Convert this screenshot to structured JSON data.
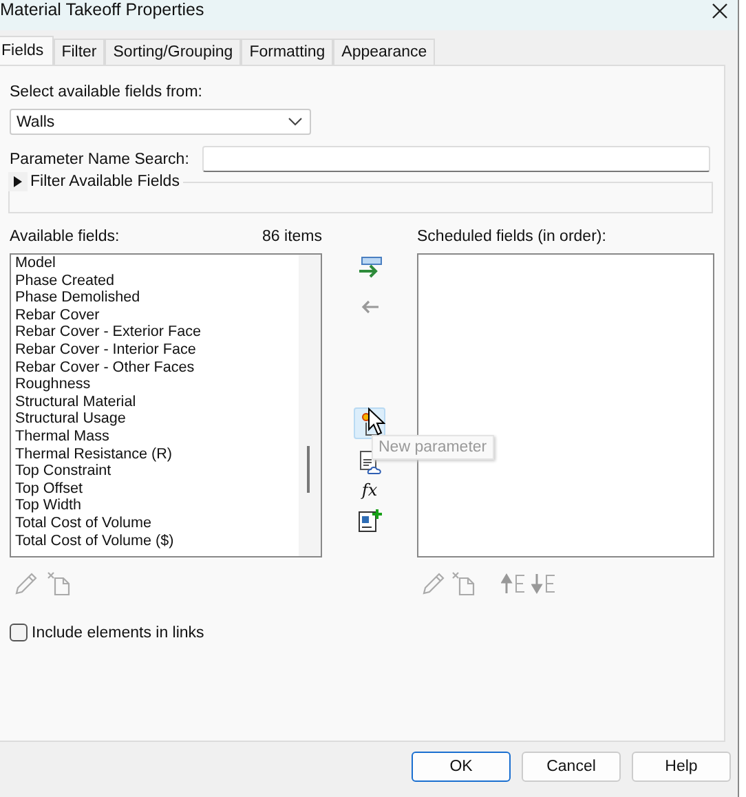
{
  "window": {
    "title": "Material Takeoff Properties"
  },
  "tabs": [
    {
      "label": "Fields",
      "selected": true
    },
    {
      "label": "Filter",
      "selected": false
    },
    {
      "label": "Sorting/Grouping",
      "selected": false
    },
    {
      "label": "Formatting",
      "selected": false
    },
    {
      "label": "Appearance",
      "selected": false
    }
  ],
  "source": {
    "label": "Select available fields from:",
    "value": "Walls"
  },
  "search": {
    "label": "Parameter Name Search:"
  },
  "filter_group": {
    "label": "Filter Available Fields",
    "expanded": false
  },
  "available": {
    "label": "Available fields:",
    "count": "86 items",
    "items": [
      "Model",
      "Phase Created",
      "Phase Demolished",
      "Rebar Cover",
      "Rebar Cover - Exterior Face",
      "Rebar Cover - Interior Face",
      "Rebar Cover - Other Faces",
      "Roughness",
      "Structural Material",
      "Structural Usage",
      "Thermal Mass",
      "Thermal Resistance (R)",
      "Top Constraint",
      "Top Offset",
      "Top Width",
      "Total Cost of Volume",
      "Total Cost of Volume ($)"
    ]
  },
  "scheduled": {
    "label": "Scheduled fields (in order):"
  },
  "formula_button": {
    "label": "fx"
  },
  "tooltip": "New parameter",
  "include_links": {
    "label": "Include elements in links",
    "checked": false
  },
  "buttons": [
    {
      "label": "OK",
      "default": true
    },
    {
      "label": "Cancel",
      "default": false
    },
    {
      "label": "Help",
      "default": false
    }
  ]
}
